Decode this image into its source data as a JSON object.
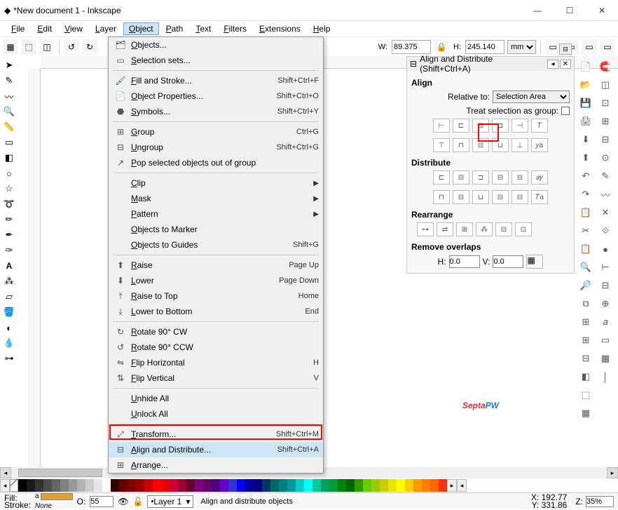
{
  "window": {
    "title": "*New document 1 - Inkscape",
    "min": "—",
    "max": "☐",
    "close": "✕"
  },
  "menubar": [
    "File",
    "Edit",
    "View",
    "Layer",
    "Object",
    "Path",
    "Text",
    "Filters",
    "Extensions",
    "Help"
  ],
  "toolbar": {
    "w_label": "W:",
    "w_value": "89.375",
    "h_label": "H:",
    "h_value": "245.140",
    "units": "mm"
  },
  "dropdown": {
    "items": [
      {
        "icon": "🗂",
        "label": "Objects...",
        "sc": ""
      },
      {
        "icon": "▭",
        "label": "Selection sets...",
        "sc": ""
      },
      {
        "sep": true
      },
      {
        "icon": "🖌",
        "label": "Fill and Stroke...",
        "sc": "Shift+Ctrl+F"
      },
      {
        "icon": "📄",
        "label": "Object Properties...",
        "sc": "Shift+Ctrl+O"
      },
      {
        "icon": "⬣",
        "label": "Symbols...",
        "sc": "Shift+Ctrl+Y"
      },
      {
        "sep": true
      },
      {
        "icon": "⊞",
        "label": "Group",
        "sc": "Ctrl+G"
      },
      {
        "icon": "⊟",
        "label": "Ungroup",
        "sc": "Shift+Ctrl+G"
      },
      {
        "icon": "↗",
        "label": "Pop selected objects out of group",
        "sc": ""
      },
      {
        "sep": true
      },
      {
        "icon": "",
        "label": "Clip",
        "sc": "",
        "sub": true
      },
      {
        "icon": "",
        "label": "Mask",
        "sc": "",
        "sub": true
      },
      {
        "icon": "",
        "label": "Pattern",
        "sc": "",
        "sub": true
      },
      {
        "icon": "",
        "label": "Objects to Marker",
        "sc": ""
      },
      {
        "icon": "",
        "label": "Objects to Guides",
        "sc": "Shift+G"
      },
      {
        "sep": true
      },
      {
        "icon": "⬆",
        "label": "Raise",
        "sc": "Page Up"
      },
      {
        "icon": "⬇",
        "label": "Lower",
        "sc": "Page Down"
      },
      {
        "icon": "⤒",
        "label": "Raise to Top",
        "sc": "Home"
      },
      {
        "icon": "⤓",
        "label": "Lower to Bottom",
        "sc": "End"
      },
      {
        "sep": true
      },
      {
        "icon": "↻",
        "label": "Rotate 90° CW",
        "sc": ""
      },
      {
        "icon": "↺",
        "label": "Rotate 90° CCW",
        "sc": ""
      },
      {
        "icon": "⇋",
        "label": "Flip Horizontal",
        "sc": "H"
      },
      {
        "icon": "⇅",
        "label": "Flip Vertical",
        "sc": "V"
      },
      {
        "sep": true
      },
      {
        "icon": "",
        "label": "Unhide All",
        "sc": ""
      },
      {
        "icon": "",
        "label": "Unlock All",
        "sc": ""
      },
      {
        "sep": true
      },
      {
        "icon": "⤢",
        "label": "Transform...",
        "sc": "Shift+Ctrl+M"
      },
      {
        "icon": "⊟",
        "label": "Align and Distribute...",
        "sc": "Shift+Ctrl+A",
        "hl": true
      },
      {
        "icon": "⊞",
        "label": "Arrange...",
        "sc": ""
      }
    ]
  },
  "panel": {
    "title": "Align and Distribute (Shift+Ctrl+A)",
    "align": "Align",
    "relative_to_label": "Relative to:",
    "relative_to_value": "Selection Area",
    "treat_label": "Treat selection as group:",
    "distribute": "Distribute",
    "rearrange": "Rearrange",
    "remove_overlaps": "Remove overlaps",
    "h_label": "H:",
    "h_value": "0.0",
    "v_label": "V:",
    "v_value": "0.0"
  },
  "watermark": {
    "a": "Septa",
    "b": "PW"
  },
  "status": {
    "fill_label": "Fill:",
    "fill_value": "a",
    "stroke_label": "Stroke:",
    "stroke_value": "None",
    "opacity_label": "O:",
    "opacity_value": "55",
    "layer": "Layer 1",
    "message": "Align and distribute objects",
    "x_label": "X:",
    "x_value": "192.77",
    "y_label": "Y:",
    "y_value": "331.86",
    "z_label": "Z:",
    "z_value": "35%"
  },
  "palette_colors": [
    "#000000",
    "#1a1a1a",
    "#333333",
    "#4d4d4d",
    "#666666",
    "#808080",
    "#999999",
    "#b3b3b3",
    "#cccccc",
    "#e6e6e6",
    "#ffffff",
    "#330000",
    "#660000",
    "#800000",
    "#990000",
    "#cc0000",
    "#ff0000",
    "#e60000",
    "#cc0033",
    "#990033",
    "#660033",
    "#800080",
    "#660066",
    "#4b0082",
    "#6600cc",
    "#3333cc",
    "#0000ff",
    "#0000a0",
    "#000080",
    "#003366",
    "#006666",
    "#008080",
    "#009999",
    "#00cccc",
    "#00ffff",
    "#00cc99",
    "#00a060",
    "#009933",
    "#008000",
    "#006600",
    "#339900",
    "#66cc00",
    "#99cc00",
    "#cccc00",
    "#e6e600",
    "#ffff00",
    "#ffcc00",
    "#ff9900",
    "#ff8000",
    "#ff6600",
    "#ff3300"
  ]
}
